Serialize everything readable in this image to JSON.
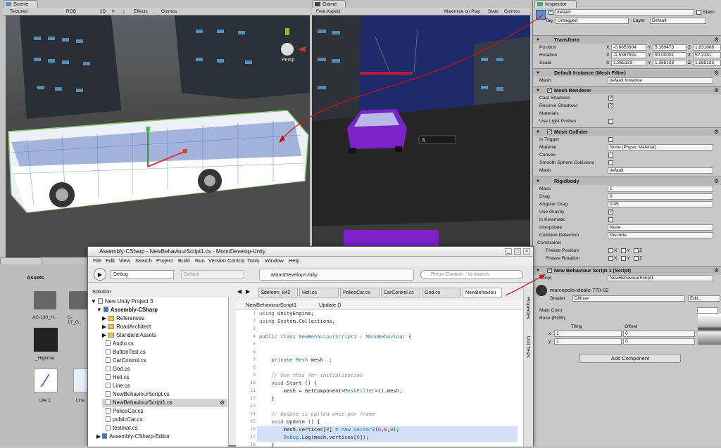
{
  "scene": {
    "tab": "Scene",
    "shading": "Textured",
    "color": "RGB",
    "mode2d": "2D",
    "effects": "Effects",
    "gizmos": "Gizmos",
    "persp": "Persp"
  },
  "game": {
    "tab": "Game",
    "aspect": "Free Aspect",
    "maximize": "Maximize on Play",
    "stats": "Stats",
    "gizmos": "Gizmos",
    "label": "4"
  },
  "inspector": {
    "tab": "Inspector",
    "object_name": "default",
    "static": "Static",
    "tag_label": "Tag",
    "tag": "Untagged",
    "layer_label": "Layer",
    "layer": "Default",
    "transform": {
      "title": "Transform",
      "pos_label": "Position",
      "rot_label": "Rotation",
      "scale_label": "Scale",
      "pos": [
        "-0.6653804",
        "5.169473",
        "1.831688"
      ],
      "rot": [
        "-1.536792e",
        "90.00001",
        "57.2151"
      ],
      "scale": [
        "1.265133",
        "1.265133",
        "1.265133"
      ]
    },
    "mesh_filter": {
      "title": "Default Instance (Mesh Filter)",
      "mesh_label": "Mesh",
      "mesh": "default Instance"
    },
    "mesh_renderer": {
      "title": "Mesh Renderer",
      "cast": "Cast Shadows",
      "receive": "Receive Shadows",
      "materials": "Materials",
      "light_probes": "Use Light Probes"
    },
    "mesh_collider": {
      "title": "Mesh Collider",
      "trigger": "Is Trigger",
      "material_label": "Material",
      "material": "None (Physic Material)",
      "convex": "Convex",
      "smooth": "Smooth Sphere Collisions",
      "mesh_label": "Mesh",
      "mesh": "default"
    },
    "rigidbody": {
      "title": "Rigidbody",
      "mass_label": "Mass",
      "mass": "1",
      "drag_label": "Drag",
      "drag": "0",
      "adrag_label": "Angular Drag",
      "adrag": "0.05",
      "gravity": "Use Gravity",
      "kinematic": "Is Kinematic",
      "interp_label": "Interpolate",
      "interp": "None",
      "coll_label": "Collision Detection",
      "coll": "Discrete",
      "constraints": "Constraints",
      "freeze_pos": "Freeze Position",
      "freeze_rot": "Freeze Rotation"
    },
    "script_comp": {
      "title": "New Behaviour Script 1 (Script)",
      "script_label": "Script",
      "script": "NewBehaviourScript1"
    },
    "material": {
      "name": "marcopolo-ideale-770-02",
      "shader_label": "Shader",
      "shader": "Diffuse",
      "edit": "Edit...",
      "main_color": "Main Color",
      "base": "Base (RGB)",
      "tiling": "Tiling",
      "offset": "Offset",
      "tx": "1",
      "ty": "1",
      "ox": "0",
      "oy": "0"
    },
    "add_component": "Add Component"
  },
  "assets": {
    "header": "Assets",
    "items": [
      "AC-130_H...",
      "C-17_G...",
      "_Highrise",
      "Life 1",
      "Line"
    ]
  },
  "monodevelop": {
    "title": "Assembly-CSharp - NewBehaviourScript1.cs - MonoDevelop-Unity",
    "menu": [
      "File",
      "Edit",
      "View",
      "Search",
      "Project",
      "Build",
      "Run",
      "Version Control",
      "Tools",
      "Window",
      "Help"
    ],
    "config": "Debug",
    "platform": "Default",
    "status": "MonoDevelop-Unity",
    "search_placeholder": "Press 'Control+,' to search",
    "solution_header": "Solution",
    "tree": [
      "New Unity Project 3",
      "Assembly-CSharp",
      "References",
      "RoadArchitect",
      "Standard Assets",
      "Audio.cs",
      "ButtonTest.cs",
      "CarControl.cs",
      "God.cs",
      "Heli.cs",
      "Line.cs",
      "NewBehaviourScript.cs",
      "NewBehaviourScript1.cs",
      "PoliceCar.cs",
      "publicCar.cs",
      "testmat.cs",
      "Assembly-CSharp-Editor"
    ],
    "tabs": [
      "$deform_842",
      "Heli.cs",
      "PoliceCar.cs",
      "CarControl.cs",
      "God.cs",
      "NewBehaviou"
    ],
    "breadcrumb_class": "NewBehaviourScript1",
    "breadcrumb_method": "Update ()",
    "side_tabs": [
      "Properties",
      "Unit Tests"
    ]
  }
}
